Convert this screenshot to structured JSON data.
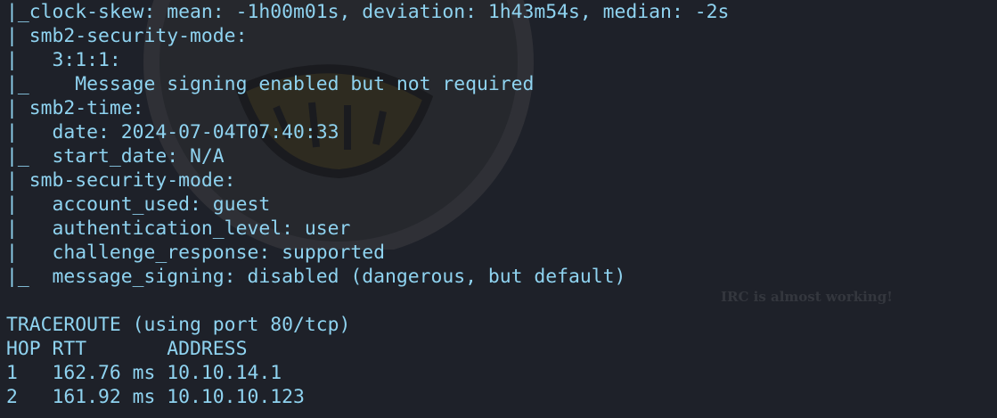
{
  "terminal": {
    "lines": [
      "|_clock-skew: mean: -1h00m01s, deviation: 1h43m54s, median: -2s",
      "| smb2-security-mode:",
      "|   3:1:1:",
      "|_    Message signing enabled but not required",
      "| smb2-time:",
      "|   date: 2024-07-04T07:40:33",
      "|_  start_date: N/A",
      "| smb-security-mode:",
      "|   account_used: guest",
      "|   authentication_level: user",
      "|   challenge_response: supported",
      "|_  message_signing: disabled (dangerous, but default)",
      "",
      "TRACEROUTE (using port 80/tcp)",
      "HOP RTT       ADDRESS",
      "1   162.76 ms 10.10.14.1",
      "2   161.92 ms 10.10.10.123"
    ],
    "text_color": "#8fd3f0",
    "background_color": "#1e2129"
  },
  "overlay": {
    "irc_note": "IRC is almost working!"
  },
  "watermark": {
    "icon": "grinning-face-logo-icon"
  }
}
